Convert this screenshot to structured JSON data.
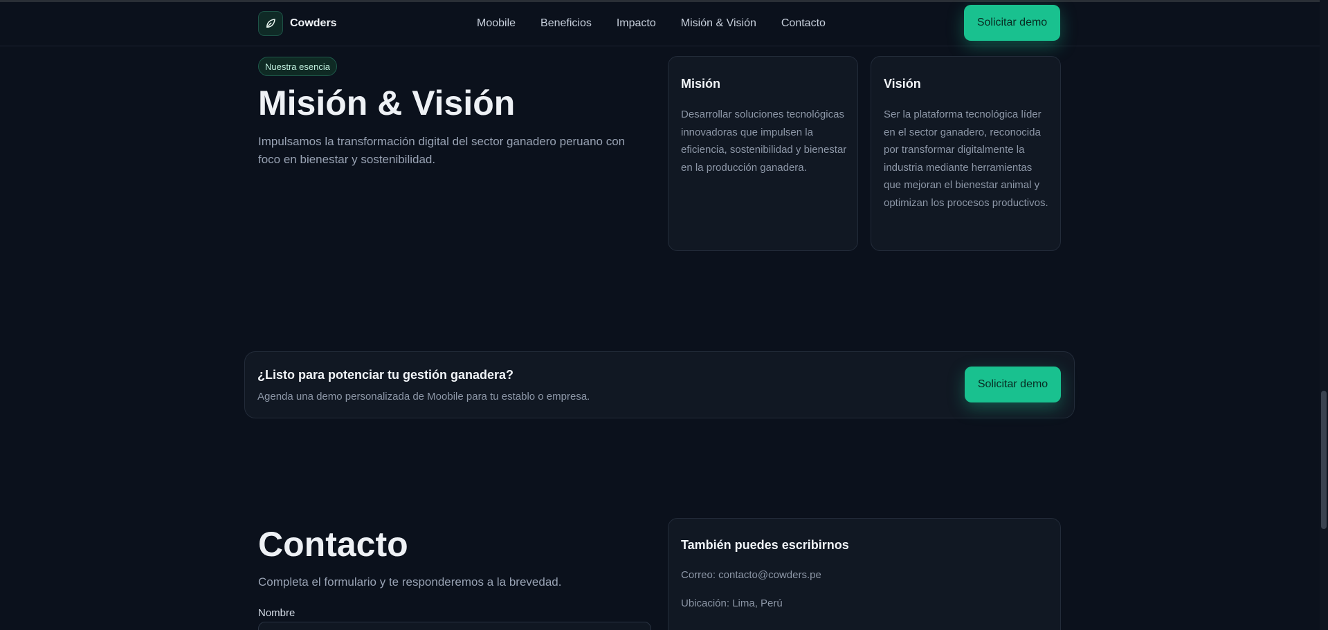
{
  "header": {
    "logo_text": "Cowders",
    "nav": [
      "Moobile",
      "Beneficios",
      "Impacto",
      "Misión & Visión",
      "Contacto"
    ],
    "cta_label": "Solicitar demo"
  },
  "mission_vision": {
    "badge": "Nuestra esencia",
    "title": "Misión & Visión",
    "subtitle": "Impulsamos la transformación digital del sector ganadero peruano con foco en bienestar y sostenibilidad.",
    "mision": {
      "title": "Misión",
      "text": "Desarrollar soluciones tecnológicas innovadoras que impulsen la eficiencia, sostenibilidad y bienestar en la producción ganadera."
    },
    "vision": {
      "title": "Visión",
      "text": "Ser la plataforma tecnológica líder en el sector ganadero, reconocida por transformar digitalmente la industria mediante herramientas que mejoran el bienestar animal y optimizan los procesos productivos."
    }
  },
  "cta": {
    "title": "¿Listo para potenciar tu gestión ganadera?",
    "text": "Agenda una demo personalizada de Moobile para tu establo o empresa.",
    "button_label": "Solicitar demo"
  },
  "contact": {
    "title": "Contacto",
    "subtitle": "Completa el formulario y te responderemos a la brevedad.",
    "name_label": "Nombre",
    "name_value": "",
    "card": {
      "title": "También puedes escribirnos",
      "email_line": "Correo: contacto@cowders.pe",
      "location_line": "Ubicación: Lima, Perú"
    }
  },
  "colors": {
    "background": "#0b111c",
    "accent": "#19c18f",
    "card_bg": "#111823"
  }
}
